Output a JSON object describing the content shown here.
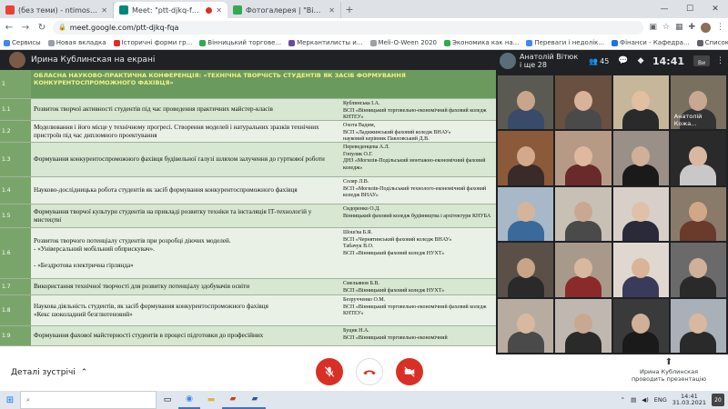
{
  "browser": {
    "tabs": [
      {
        "title": "(без теми) - ntimoschenkom@g",
        "favicon_color": "#ea4335",
        "active": false
      },
      {
        "title": "Meet: \"ptt-djkq-fqa\"",
        "favicon_color": "#00897b",
        "active": true
      },
      {
        "title": "Фотогалерея | \"Вінницький торг",
        "favicon_color": "#34a853",
        "active": false
      }
    ],
    "window_controls": [
      "—",
      "☐",
      "✕"
    ],
    "address": "meet.google.com/ptt-djkq-fqa",
    "bookmarks": [
      "Сервисы",
      "Новая вкладка",
      "Історичні форми гр...",
      "Вінницький торгове...",
      "Меркантилисты и...",
      "Meli-O-Ween 2020",
      "Экономика как на...",
      "Переваги і недолік...",
      "Фінанси - Кафедра..."
    ],
    "bookmarks_other": "Список для чтения"
  },
  "presentation": {
    "presenter_label": "Ирина Кублинская на екрані",
    "table": {
      "header_num": "1",
      "header_title": "ОБЛАСНА НАУКОВО-ПРАКТИЧНА КОНФЕРЕНЦІЯ: «ТЕХНІЧНА ТВОРЧІСТЬ СТУДЕНТІВ ЯК ЗАСІБ ФОРМУВАННЯ КОНКУРЕНТОСПРОМОЖНОГО ФАХІВЦЯ»",
      "rows": [
        {
          "num": "1.1",
          "topic": "Розвиток творчої активності студентів під час проведення практичних майстер-класів",
          "author": "Кублинська І.А.\nВСП «Вінницький торговельно-економічний фаховий коледж КНТЕУ»"
        },
        {
          "num": "1.2",
          "topic": "Моделювання і його місце у технічному прогресі. Створення моделей і натуральних зразків технічних пристроїв під час дипломного проектування",
          "author": "Охота Вадим,\nВСП «Ладижинський фаховий коледж ВНАУ»\nнауковий керівник Павловський Д.В."
        },
        {
          "num": "1.3",
          "topic": "Формування конкурентоспроможного фахівця будівельної галузі шляхом залучення до гурткової роботи",
          "author": "Переведенцева А.Л.\nГопулик О.Г.\nДНЗ «Могилів-Подільський монтажно-економічний фаховий коледж»"
        },
        {
          "num": "1.4",
          "topic": "Науково-дослідницька робота студентів як засіб формування конкурентоспроможного фахівця",
          "author": "Соляр Л.В.\nВСП «Могилів-Подільський технолого-економічний фаховий коледж ВНАУ»"
        },
        {
          "num": "1.5",
          "topic": "Формування творчої культури студентів на прикладі розвитку техніки та інсталяція ІТ-технологій у мистецтві",
          "author": "Сидоренко О.Д.\nВінницький фаховий коледж будівництва і архітектури КНУБА"
        },
        {
          "num": "1.6",
          "topic": "Розвиток творчого потенціалу студентів при розробці діючих моделей.\n- «Універсальний мобільний обприскувач».\n\n- «Бездротова електрична гірлянда»",
          "author": "Шош'ва Б.Я.\nВСП «Чернятинський фаховий коледж ВНАУ»\nТабачук В.О.\nВСП «Вінницький фаховий коледж НУХТ»"
        },
        {
          "num": "1.7",
          "topic": "Використання технічної творчості для розвитку потенціалу здобувачів освіти",
          "author": "Смельянов Б.В.\nВСП «Вінницький фаховий коледж НУХТ»"
        },
        {
          "num": "1.8",
          "topic": "Наукова діяльність студентів, як засіб формування конкурентоспроможного фахівця\n«Кекс шоколадний безглютеновий»",
          "author": "Безручченко О.М.\nВСП «Вінницький торговельно-економічний фаховий коледж КНТЕУ»"
        },
        {
          "num": "1.9",
          "topic": "Формування фахової майстерності студентів в процесі підготовки до професійних",
          "author": "Буцик Н.А.\nВСП «Вінницький торговельно-економічний"
        }
      ]
    }
  },
  "participants_panel": {
    "pinned_name": "Анатолій Вітюк",
    "pinned_sub": "і ще 28",
    "count": "45",
    "time": "14:41",
    "self_label": "Ви",
    "tiles": [
      {
        "label": "",
        "bg": "#5a5a52",
        "face": "#c9a58c",
        "body": "#3a4a6a"
      },
      {
        "label": "",
        "bg": "#6a5040",
        "face": "#d8b39a",
        "body": "#4a4a4a"
      },
      {
        "label": "",
        "bg": "#c7b79a",
        "face": "#e0c0a0",
        "body": "#2a2a2a"
      },
      {
        "label": "Анатолій Кожа...",
        "bg": "#7a7060",
        "face": "#c8a890",
        "body": "#333"
      },
      {
        "label": "",
        "bg": "#8a5a3a",
        "face": "#d4a88a",
        "body": "#3a2a2a"
      },
      {
        "label": "",
        "bg": "#b79a86",
        "face": "#e0b8a0",
        "body": "#6a2a2a"
      },
      {
        "label": "",
        "bg": "#9a9088",
        "face": "#d0b098",
        "body": "#1a1a1a"
      },
      {
        "label": "",
        "bg": "#2a2a2a",
        "face": "#d8b8a0",
        "body": "#c8c8c8"
      },
      {
        "label": "",
        "bg": "#a8b8c8",
        "face": "#d4b49c",
        "body": "#3a6a9a"
      },
      {
        "label": "",
        "bg": "#c8c0b4",
        "face": "#c8a890",
        "body": "#4a4a4a"
      },
      {
        "label": "",
        "bg": "#d8d0c8",
        "face": "#e0c0a8",
        "body": "#2a2a3a"
      },
      {
        "label": "",
        "bg": "#8a7a6a",
        "face": "#d0a888",
        "body": "#6a3a2a"
      },
      {
        "label": "",
        "bg": "#5a5048",
        "face": "#c8a488",
        "body": "#2a2a2a"
      },
      {
        "label": "",
        "bg": "#a89a8a",
        "face": "#d8b8a0",
        "body": "#8a2a2a"
      },
      {
        "label": "",
        "bg": "#e0d8d0",
        "face": "#d8b498",
        "body": "#3a3a5a"
      },
      {
        "label": "",
        "bg": "#6a6a6a",
        "face": "#d0b09a",
        "body": "#2a2a2a"
      },
      {
        "label": "",
        "bg": "#b8aca0",
        "face": "#d8b8a0",
        "body": "#4a4a4a"
      },
      {
        "label": "",
        "bg": "#c0b8b0",
        "face": "#c8a890",
        "body": "#2a2a2a"
      },
      {
        "label": "",
        "bg": "#3a3a3a",
        "face": "#d0b098",
        "body": "#1a1a1a"
      },
      {
        "label": "",
        "bg": "#aab0b8",
        "face": "#d8b8a0",
        "body": "#2a2a2a"
      }
    ]
  },
  "bottom_bar": {
    "details_label": "Деталі зустрічі",
    "presenting_name": "Ирина Кублинская",
    "presenting_sub": "проводить презентацію"
  },
  "taskbar": {
    "search_placeholder": "",
    "lang": "ENG",
    "time": "14:41",
    "date": "31.03.2021",
    "notifications": "20"
  }
}
